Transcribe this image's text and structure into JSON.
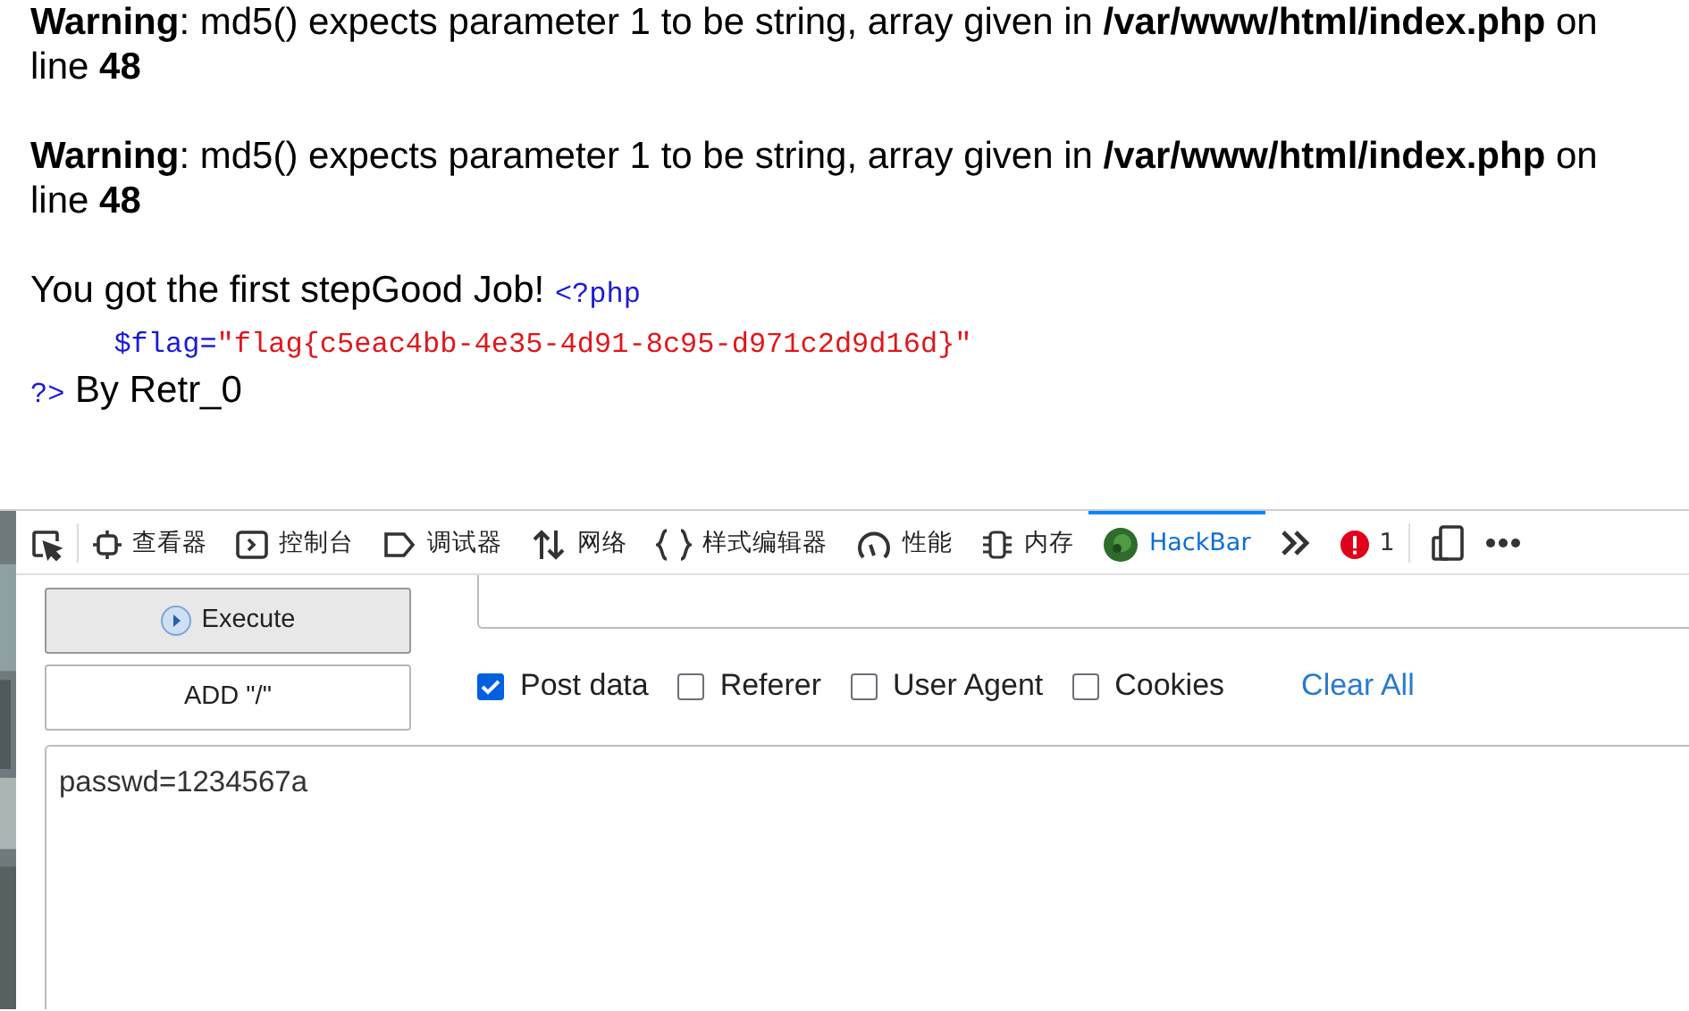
{
  "page": {
    "warnings": [
      "**Warning**: md5() expects parameter 1 to be string, array given in **/var/www/html/index.php** on line **48**",
      "**Warning**: md5() expects parameter 1 to be string, array given in **/var/www/html/index.php** on line **48**"
    ],
    "output_lines": [
      {
        "tokens": [
          {
            "kind": "text",
            "text": "You got the first stepGood Job!"
          },
          {
            "kind": "php",
            "text": "<?php"
          }
        ]
      },
      {
        "tokens": [
          {
            "kind": "php",
            "text": "\t$flag="
          },
          {
            "kind": "string",
            "text": "\"flag{c5eac4bb-4e35-4d91-8c95-d971c2d9d16d}\""
          }
        ]
      },
      {
        "tokens": [
          {
            "kind": "php",
            "text": "?>"
          },
          {
            "kind": "text",
            "text": "By Retr_0"
          }
        ]
      }
    ]
  },
  "devtools": {
    "tabs": [
      {
        "kind": "picker",
        "selected": false
      },
      {
        "kind": "inspector",
        "label": "查看器",
        "selected": false
      },
      {
        "kind": "console",
        "label": "控制台",
        "selected": false
      },
      {
        "kind": "debugger",
        "label": "调试器",
        "selected": false
      },
      {
        "kind": "network",
        "label": "网络",
        "selected": false
      },
      {
        "kind": "style",
        "label": "样式编辑器",
        "selected": false
      },
      {
        "kind": "performance",
        "label": "性能",
        "selected": false
      },
      {
        "kind": "memory",
        "label": "内存",
        "selected": false
      },
      {
        "kind": "hackbar",
        "label": "HackBar",
        "selected": true
      }
    ],
    "error_count": "1"
  },
  "hackbar": {
    "buttons": [
      "Execute",
      "ADD \"/\""
    ],
    "options": [
      {
        "label": "Post data",
        "checked": true
      },
      {
        "label": "Referer",
        "checked": false
      },
      {
        "label": "User Agent",
        "checked": false
      },
      {
        "label": "Cookies",
        "checked": false
      }
    ],
    "clear_link": "Clear All",
    "post_body": "passwd=1234567a"
  }
}
